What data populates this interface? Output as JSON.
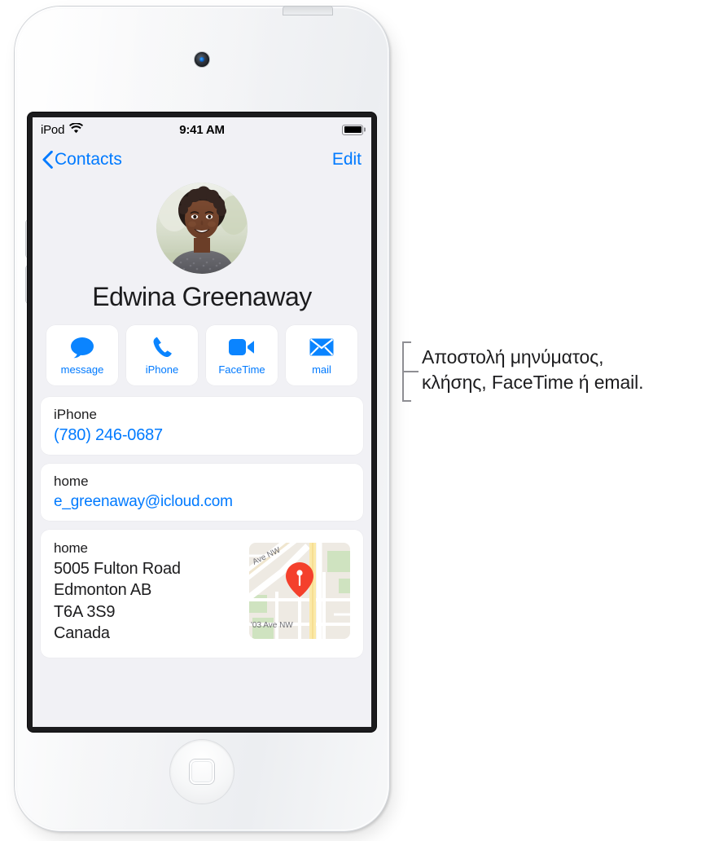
{
  "device": {
    "name": "iPod touch",
    "camera": "front-camera",
    "home_button": "home-button",
    "power_button": "power-button",
    "volume_up": "volume-up-button",
    "volume_down": "volume-down-button"
  },
  "status_bar": {
    "carrier": "iPod",
    "wifi_icon": "wifi-icon",
    "time": "9:41 AM",
    "battery_icon": "battery-full-icon"
  },
  "nav_bar": {
    "back_icon": "chevron-left-icon",
    "back_label": "Contacts",
    "edit_label": "Edit"
  },
  "contact": {
    "avatar": "contact-photo",
    "name": "Edwina Greenaway"
  },
  "actions": [
    {
      "icon": "message-bubble-icon",
      "label": "message"
    },
    {
      "icon": "phone-handset-icon",
      "label": "iPhone"
    },
    {
      "icon": "video-camera-icon",
      "label": "FaceTime"
    },
    {
      "icon": "mail-envelope-icon",
      "label": "mail"
    }
  ],
  "fields": {
    "phone": {
      "label": "iPhone",
      "value": "(780) 246-0687"
    },
    "email": {
      "label": "home",
      "value": "e_greenaway@icloud.com"
    },
    "address": {
      "label": "home",
      "lines": [
        "5005 Fulton Road",
        "Edmonton AB",
        "T6A 3S9",
        "Canada"
      ],
      "map": {
        "pin_icon": "map-pin-icon",
        "street_labels": [
          "Ave NW",
          "'03 Ave NW"
        ]
      }
    }
  },
  "callout": {
    "bracket_icon": "callout-bracket-icon",
    "text": "Αποστολή μηνύματος,\nκλήσης, FaceTime ή email."
  },
  "colors": {
    "accent_blue": "#007aff",
    "screen_bg": "#f1f1f5",
    "card_bg": "#ffffff",
    "text_primary": "#1c1c1e",
    "pin_red": "#f4402c"
  }
}
